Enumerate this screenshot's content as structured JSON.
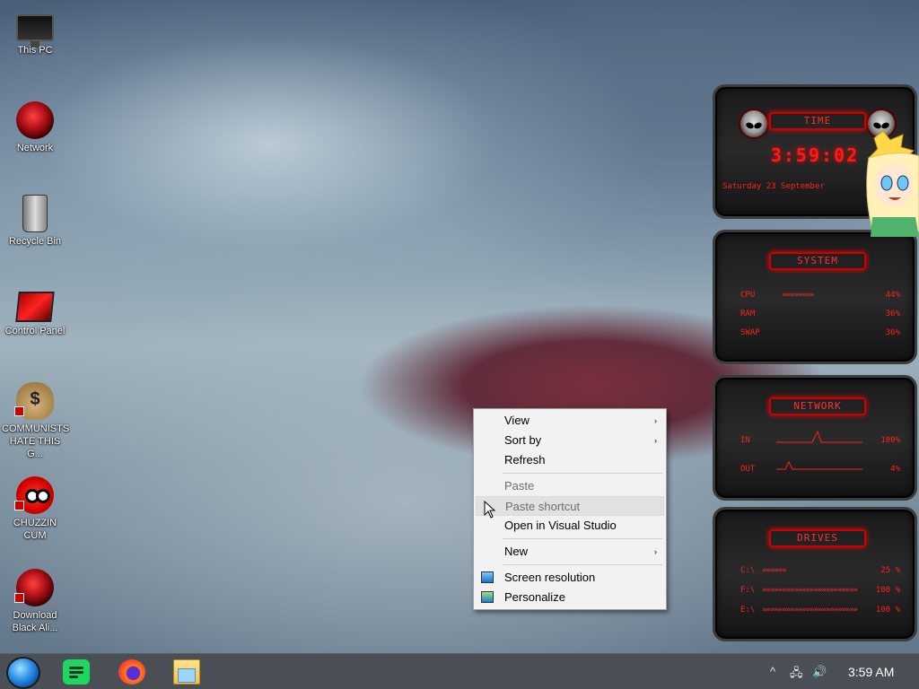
{
  "desktop": {
    "icons": [
      {
        "label": "This PC"
      },
      {
        "label": "Network"
      },
      {
        "label": "Recycle Bin"
      },
      {
        "label": "Control Panel"
      },
      {
        "label": "COMMUNISTS HATE THIS G..."
      },
      {
        "label": "CHUZZIN CUM"
      },
      {
        "label": "Download Black Ali..."
      }
    ]
  },
  "context_menu": {
    "items": [
      {
        "label": "View",
        "submenu": true
      },
      {
        "label": "Sort by",
        "submenu": true
      },
      {
        "label": "Refresh"
      },
      {
        "label": "Paste",
        "disabled": true
      },
      {
        "label": "Paste shortcut",
        "disabled": true
      },
      {
        "label": "Open in Visual Studio"
      },
      {
        "label": "New",
        "submenu": true
      },
      {
        "label": "Screen resolution"
      },
      {
        "label": "Personalize"
      }
    ],
    "arrow": "›"
  },
  "gadgets": {
    "time": {
      "title": "TIME",
      "clock": "3:59:02",
      "date": "Saturday 23 September"
    },
    "system": {
      "title": "SYSTEM",
      "rows": [
        {
          "label": "CPU",
          "bar": "»»»»»»»»",
          "value": "44%"
        },
        {
          "label": "RAM",
          "bar": "",
          "value": "36%"
        },
        {
          "label": "SWAP",
          "bar": "",
          "value": "36%"
        }
      ]
    },
    "network": {
      "title": "NETWORK",
      "rows": [
        {
          "label": "IN",
          "value": "100%"
        },
        {
          "label": "OUT",
          "value": "4%"
        }
      ]
    },
    "drives": {
      "title": "DRIVES",
      "rows": [
        {
          "label": "C:\\",
          "bar": "»»»»»»",
          "value": "25 %"
        },
        {
          "label": "F:\\",
          "bar": "»»»»»»»»»»»»»»»»»»»»»»»»",
          "value": "100 %"
        },
        {
          "label": "E:\\",
          "bar": "»»»»»»»»»»»»»»»»»»»»»»»»",
          "value": "100 %"
        }
      ]
    }
  },
  "taskbar": {
    "clock": "3:59 AM",
    "tray": {
      "chevron": "^",
      "network": "🖧",
      "volume": "🔊"
    }
  },
  "colors": {
    "accent_red": "#ff2020",
    "taskbar": "#4a4f55",
    "menu_bg": "#f2f2f2"
  }
}
